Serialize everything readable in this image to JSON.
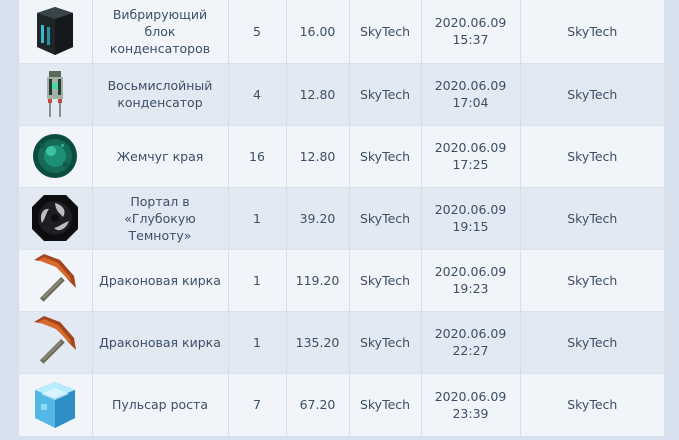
{
  "rows": [
    {
      "icon": "vibrating-capacitor-bank-icon",
      "item": "Вибрирующий блок конденсаторов",
      "qty": "5",
      "price": "16.00",
      "seller": "SkyTech",
      "date": "2020.06.09",
      "time": "15:37",
      "buyer": "SkyTech"
    },
    {
      "icon": "octadic-capacitor-icon",
      "item": "Восьмислойный конденсатор",
      "qty": "4",
      "price": "12.80",
      "seller": "SkyTech",
      "date": "2020.06.09",
      "time": "17:04",
      "buyer": "SkyTech"
    },
    {
      "icon": "ender-pearl-icon",
      "item": "Жемчуг края",
      "qty": "16",
      "price": "12.80",
      "seller": "SkyTech",
      "date": "2020.06.09",
      "time": "17:25",
      "buyer": "SkyTech"
    },
    {
      "icon": "deep-dark-portal-icon",
      "item": "Портал в «Глубокую Темноту»",
      "qty": "1",
      "price": "39.20",
      "seller": "SkyTech",
      "date": "2020.06.09",
      "time": "19:15",
      "buyer": "SkyTech"
    },
    {
      "icon": "draconic-pickaxe-icon",
      "item": "Драконовая кирка",
      "qty": "1",
      "price": "119.20",
      "seller": "SkyTech",
      "date": "2020.06.09",
      "time": "19:23",
      "buyer": "SkyTech"
    },
    {
      "icon": "draconic-pickaxe-icon",
      "item": "Драконовая кирка",
      "qty": "1",
      "price": "135.20",
      "seller": "SkyTech",
      "date": "2020.06.09",
      "time": "22:27",
      "buyer": "SkyTech"
    },
    {
      "icon": "growth-pulsar-icon",
      "item": "Пульсар роста",
      "qty": "7",
      "price": "67.20",
      "seller": "SkyTech",
      "date": "2020.06.09",
      "time": "23:39",
      "buyer": "SkyTech"
    }
  ],
  "colors": {
    "row_even": "#f1f4f9",
    "row_odd": "#e3e9f2",
    "text": "#3d4f66"
  }
}
